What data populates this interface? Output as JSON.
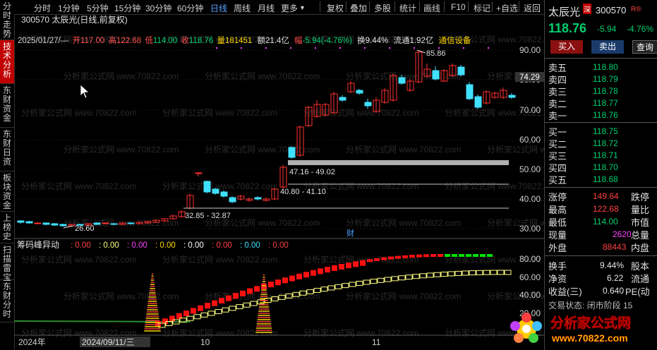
{
  "left_tabs": [
    "分时走势",
    "技术分析",
    "东财资金",
    "东财日资",
    "板块资金",
    "上榜史",
    "扫描雷宝",
    "东财分时"
  ],
  "toolbar": {
    "periods": [
      "分时",
      "1分钟",
      "5分钟",
      "15分钟",
      "30分钟",
      "60分钟",
      "日线",
      "周线",
      "月线",
      "更多"
    ],
    "actions": [
      "复权",
      "叠加",
      "多股",
      "统计",
      "画线",
      "F10",
      "标记",
      "+自选",
      "返回"
    ]
  },
  "chart_header": {
    "code_name": "300570 太辰光(日线,前复权)",
    "date": "2025/01/27/—",
    "open_label": "开",
    "open": "117.00",
    "high_label": "高",
    "high": "122.68",
    "low_label": "低",
    "low": "114.00",
    "close_label": "收",
    "close": "118.76",
    "vol_label": "量",
    "vol": "181451",
    "amount": "额21.4亿",
    "chg_label": "幅",
    "chg": "-5.94(-4.76%)",
    "turnover": "换9.44%",
    "float": "流通1.92亿",
    "sector": "通信设备"
  },
  "annotations": {
    "peak": "85.86",
    "low": "26.60",
    "range1": "47.16 - 49.02",
    "range2": "40.80 - 41.10",
    "range3": "32.85 - 32.87",
    "current_price_tag": "74.29",
    "cai": "财"
  },
  "price_axis": [
    "90.00",
    "80.00",
    "70.00",
    "60.00",
    "50.00",
    "40.00",
    "30.00"
  ],
  "indicator": {
    "title": "筹码峰异动",
    "values": [
      ": 0.00",
      ": 0.00",
      ": 0.00",
      ": 0.00",
      ": 0.00",
      ": 0.00",
      ": 0.00",
      ": 0.00"
    ],
    "axis": [
      "80.00",
      "60.00",
      "40.00",
      "20.00"
    ]
  },
  "date_axis": [
    "2024年",
    "2024/09/11/三",
    "10",
    "11"
  ],
  "colors": {
    "up": "#ff3030",
    "down": "#40e0ff",
    "accent": "#ffd700",
    "bg": "#000000"
  },
  "quote": {
    "name": "太辰光",
    "tag": "深",
    "code": "300570",
    "rm": "R®",
    "price": "118.76",
    "change": "-5.94",
    "pct": "-4.76%",
    "buttons": [
      "买入",
      "卖出",
      "查询"
    ],
    "sell": [
      {
        "label": "卖五",
        "price": "118.80"
      },
      {
        "label": "卖四",
        "price": "118.79"
      },
      {
        "label": "卖三",
        "price": "118.78"
      },
      {
        "label": "卖二",
        "price": "118.77"
      },
      {
        "label": "卖一",
        "price": "118.76"
      }
    ],
    "buy": [
      {
        "label": "买一",
        "price": "118.75"
      },
      {
        "label": "买二",
        "price": "118.72"
      },
      {
        "label": "买三",
        "price": "118.71"
      },
      {
        "label": "买四",
        "price": "118.70"
      },
      {
        "label": "买五",
        "price": "118.68"
      }
    ],
    "stats": [
      {
        "label": "涨停",
        "value": "149.64",
        "label2": "跌停"
      },
      {
        "label": "最高",
        "value": "122.68",
        "label2": "量比"
      },
      {
        "label": "最低",
        "value": "114.00",
        "label2": "市值"
      },
      {
        "label": "现量",
        "value": "2620",
        "label2": "总量"
      },
      {
        "label": "外盘",
        "value": "88443",
        "label2": "内盘"
      }
    ],
    "stats2": [
      {
        "label": "换手",
        "value": "9.44%",
        "label2": "股本"
      },
      {
        "label": "净资",
        "value": "6.22",
        "label2": "流通"
      },
      {
        "label": "收益(三)",
        "value": "0.640",
        "label2": "PE(动"
      }
    ],
    "footer": "交易状态: 闭市阶段 15"
  },
  "watermark_text": "分析家公式网",
  "watermark_url": "www.70822.com"
}
